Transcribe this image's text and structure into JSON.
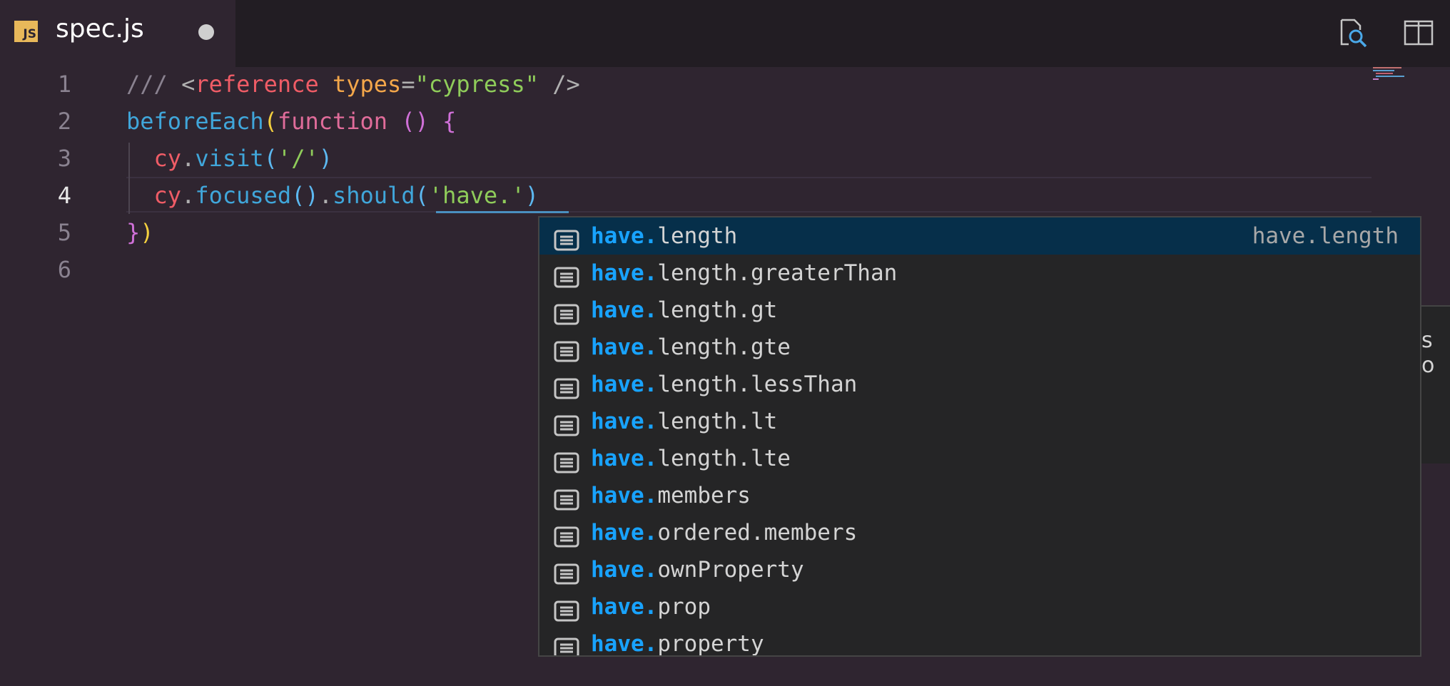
{
  "tab": {
    "icon_label": "JS",
    "title": "spec.js"
  },
  "toolbar": {
    "icons": [
      "inspect-icon",
      "split-editor-icon"
    ]
  },
  "editor": {
    "line_numbers": [
      "1",
      "2",
      "3",
      "4",
      "5",
      "6"
    ],
    "active_line": 4,
    "lines": [
      [
        {
          "t": "/// ",
          "c": "c-comment"
        },
        {
          "t": "<",
          "c": "c-punc"
        },
        {
          "t": "reference",
          "c": "c-tag"
        },
        {
          "t": " ",
          "c": "c-punc"
        },
        {
          "t": "types",
          "c": "c-attr"
        },
        {
          "t": "=",
          "c": "c-punc"
        },
        {
          "t": "\"cypress\"",
          "c": "c-str"
        },
        {
          "t": " />",
          "c": "c-punc"
        }
      ],
      [
        {
          "t": "beforeEach",
          "c": "c-fn"
        },
        {
          "t": "(",
          "c": "c-paren-y"
        },
        {
          "t": "function",
          "c": "c-kw"
        },
        {
          "t": " ",
          "c": "c-punc"
        },
        {
          "t": "()",
          "c": "c-paren-p"
        },
        {
          "t": " ",
          "c": "c-punc"
        },
        {
          "t": "{",
          "c": "c-paren-p"
        }
      ],
      [
        {
          "t": "  ",
          "c": "c-punc"
        },
        {
          "t": "cy",
          "c": "c-obj"
        },
        {
          "t": ".",
          "c": "c-punc"
        },
        {
          "t": "visit",
          "c": "c-prop"
        },
        {
          "t": "(",
          "c": "c-paren-b"
        },
        {
          "t": "'/'",
          "c": "c-str"
        },
        {
          "t": ")",
          "c": "c-paren-b"
        }
      ],
      [
        {
          "t": "  ",
          "c": "c-punc"
        },
        {
          "t": "cy",
          "c": "c-obj"
        },
        {
          "t": ".",
          "c": "c-punc"
        },
        {
          "t": "focused",
          "c": "c-prop"
        },
        {
          "t": "()",
          "c": "c-paren-b"
        },
        {
          "t": ".",
          "c": "c-punc"
        },
        {
          "t": "should",
          "c": "c-prop"
        },
        {
          "t": "(",
          "c": "c-paren-b"
        },
        {
          "t": "'have.'",
          "c": "c-str"
        },
        {
          "t": ")",
          "c": "c-paren-b"
        }
      ],
      [
        {
          "t": "}",
          "c": "c-paren-p"
        },
        {
          "t": ")",
          "c": "c-paren-y"
        }
      ],
      []
    ]
  },
  "right_peek": {
    "text": "s o"
  },
  "suggest": {
    "match_prefix": "have.",
    "items": [
      {
        "suffix": "length",
        "detail": "have.length",
        "selected": true
      },
      {
        "suffix": "length.greaterThan",
        "detail": "",
        "selected": false
      },
      {
        "suffix": "length.gt",
        "detail": "",
        "selected": false
      },
      {
        "suffix": "length.gte",
        "detail": "",
        "selected": false
      },
      {
        "suffix": "length.lessThan",
        "detail": "",
        "selected": false
      },
      {
        "suffix": "length.lt",
        "detail": "",
        "selected": false
      },
      {
        "suffix": "length.lte",
        "detail": "",
        "selected": false
      },
      {
        "suffix": "members",
        "detail": "",
        "selected": false
      },
      {
        "suffix": "ordered.members",
        "detail": "",
        "selected": false
      },
      {
        "suffix": "ownProperty",
        "detail": "",
        "selected": false
      },
      {
        "suffix": "prop",
        "detail": "",
        "selected": false
      },
      {
        "suffix": "property",
        "detail": "",
        "selected": false
      }
    ]
  },
  "colors": {
    "editor_bg": "#2f2530",
    "tabbar_bg": "#221d23",
    "suggest_bg": "#252526",
    "suggest_selected": "#062f4a",
    "match_highlight": "#18a3ff"
  }
}
